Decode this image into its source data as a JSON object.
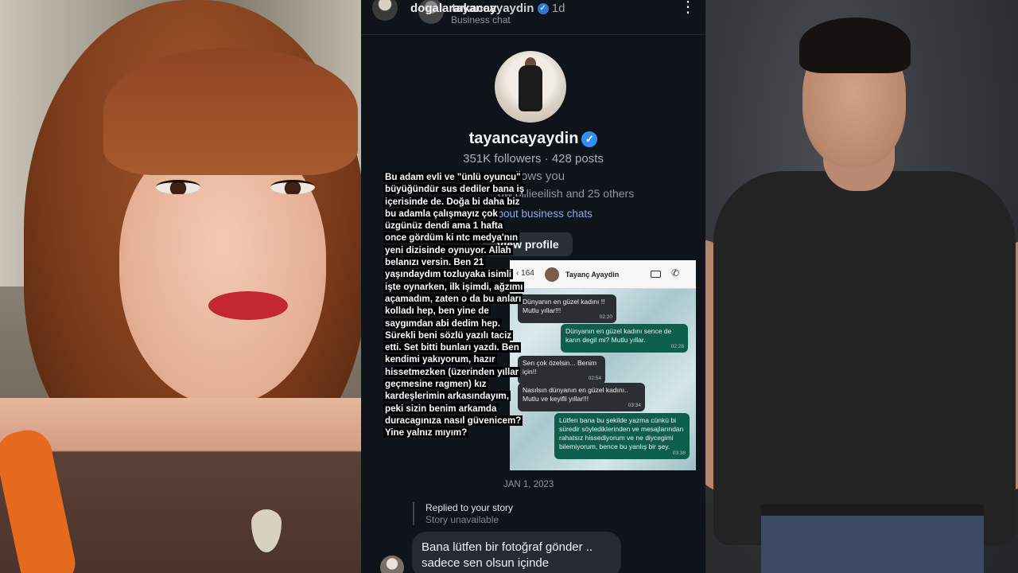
{
  "header": {
    "username_overlap_1": "dogalaraıkacay",
    "username_overlap_2": "tayancayaydin",
    "time": "1d",
    "subtitle": "Business chat",
    "more_icon": "more-vertical-icon"
  },
  "profile": {
    "username": "tayancayaydin",
    "stats": "351K followers · 428 posts",
    "follows_you": "Follows you",
    "mutual": "ow billieeilish and 25 others",
    "business_link": "about business chats",
    "view_profile": "View profile"
  },
  "story_text": "Bu adam evli ve \"ünlü oyuncu\" büyüğündür sus dediler bana iş içerisinde de. Doğa bi daha biz bu adamla çalışmayız çok üzgünüz dendi ama 1 hafta once gördüm ki ntc medya'nın yeni dizisinde oynuyor. Allah belanızı versin. Ben 21 yaşındaydım tozluyaka isimli işte oynarken, ilk işimdi, ağzımı açamadım, zaten o da bu anları kolladı hep, ben yine de saygımdan abi dedim hep. Sürekli beni sözlü yazılı taciz etti. Set bitti bunları yazdı. Ben kendimi yakıyorum, hazır hissetmezken (üzerinden yıllar geçmesine ragmen) kız kardeşlerimin arkasındayım, peki sizin benim arkamda duracagınıza nasıl güvenicem? Yine yalnız mıyım?",
  "whatsapp": {
    "back_count": "164",
    "contact": "Tayanç Ayaydin",
    "messages": [
      {
        "dir": "in",
        "text": "Dünyanın en güzel kadını !! Mutlu yıllar!!!",
        "time": "02:20"
      },
      {
        "dir": "out",
        "text": "Dünyanın en güzel kadını sence de karın degil mi? Mutlu yıllar.",
        "time": "02:28"
      },
      {
        "dir": "in",
        "text": "Sen çok özelsin... Benim için!!",
        "time": "02:54"
      },
      {
        "dir": "in",
        "text": "Nasılsın dünyanın en güzel kadını.. Mutlu ve keyifli yıllar!!!",
        "time": "03:34"
      },
      {
        "dir": "out",
        "text": "Lütfen bana bu şekilde yazma cünkü bi süredir söylediklerinden ve mesajlarından rahatsız hissediyorum ve ne diycegimi bilemiyorum, bence bu yanlış bir şey.",
        "time": "03:38"
      }
    ]
  },
  "date_separator": "JAN 1, 2023",
  "reply": {
    "title": "Replied to your story",
    "subtitle": "Story unavailable"
  },
  "last_message": "Bana lütfen bir fotoğraf gönder .. sadece sen olsun içinde",
  "colors": {
    "chat_bg": "#0f131a",
    "verified": "#2f8ef0",
    "link": "#8ea8e8",
    "wa_out": "#0d5e4d",
    "wa_in": "#2b2f33"
  }
}
